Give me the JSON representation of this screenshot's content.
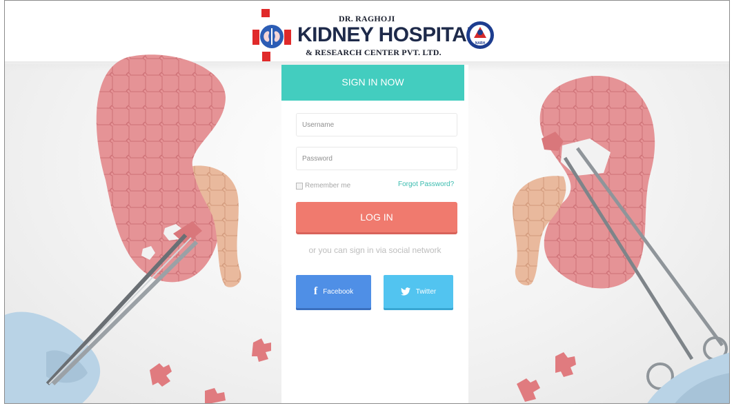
{
  "logo": {
    "line1": "DR. RAGHOJI",
    "line2": "KIDNEY HOSPITAL",
    "line3": "& RESEARCH CENTER PVT. LTD.",
    "badge_text": "NABH"
  },
  "login": {
    "title": "SIGN IN NOW",
    "username_placeholder": "Username",
    "password_placeholder": "Password",
    "remember_label": "Remember me",
    "forgot_label": "Forgot Password?",
    "login_label": "LOG IN",
    "social_text": "or you can sign in via social network",
    "facebook_label": "Facebook",
    "twitter_label": "Twitter"
  },
  "icons": {
    "facebook": "facebook-icon",
    "twitter": "twitter-icon"
  },
  "colors": {
    "accent": "#43cdbf",
    "login_button": "#f07a6e",
    "facebook": "#4f8fe6",
    "twitter": "#52c4f0"
  }
}
